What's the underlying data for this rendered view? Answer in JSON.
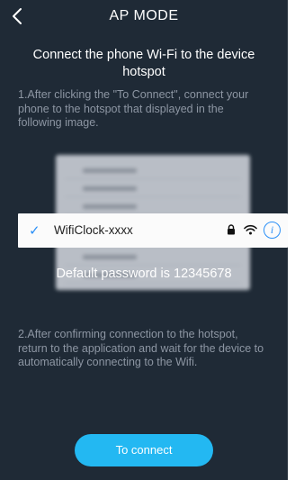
{
  "header": {
    "title": "AP MODE"
  },
  "instructions": {
    "heading": "Connect the phone Wi-Fi to the device hotspot",
    "step1": "1.After clicking the \"To Connect\", connect your phone to the hotspot that displayed in the following image.",
    "password": "Default password is 12345678",
    "step2": "2.After confirming connection to the hotspot, return to the application and wait for the device to automatically connecting to the Wifi."
  },
  "wifi_example": {
    "ssid": "WifiClock-xxxx",
    "icons": [
      "checkmark-icon",
      "lock-icon",
      "wifi-icon",
      "info-icon"
    ]
  },
  "actions": {
    "connect_label": "To connect"
  },
  "colors": {
    "background": "#1f2a36",
    "accent": "#23b8f2",
    "ios_blue": "#2a8ff7"
  }
}
